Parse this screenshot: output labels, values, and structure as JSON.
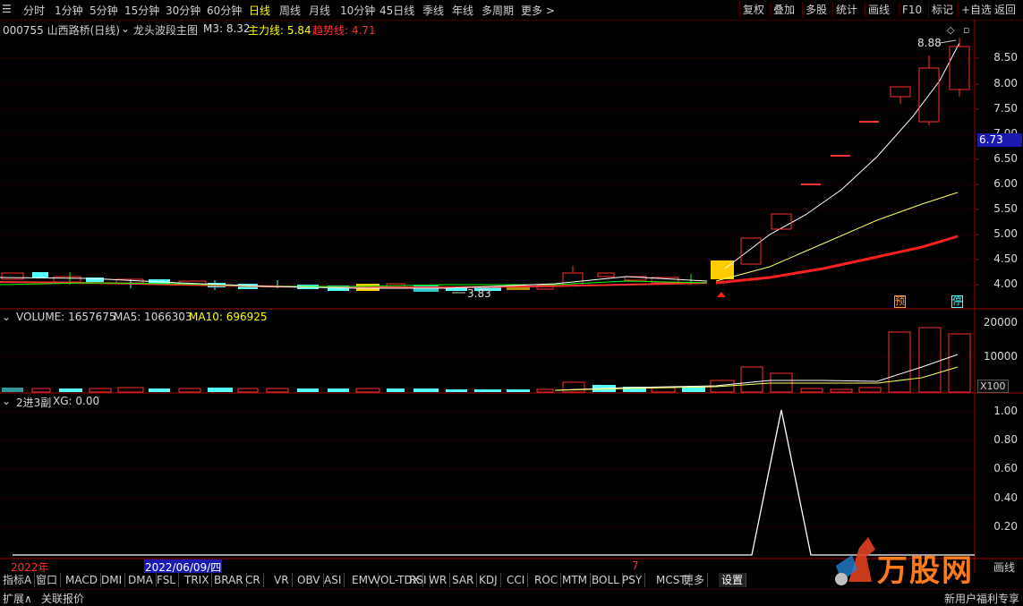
{
  "periods": [
    "分时",
    "1分钟",
    "5分钟",
    "15分钟",
    "30分钟",
    "60分钟",
    "日线",
    "周线",
    "月线",
    "10分钟",
    "45日线",
    "季线",
    "年线",
    "多周期",
    "更多 >"
  ],
  "active_period": "日线",
  "right_buttons": [
    "复权",
    "叠加",
    "多股",
    "统计",
    "画线",
    "F10",
    "标记",
    "+自选",
    "返回"
  ],
  "stock": {
    "code_name": "000755 山西路桥(日线)",
    "indicator_name": "龙头波段主图",
    "m3_label": "M3: 8.32",
    "main_line_label": "主力线: 5.84",
    "trend_line_label": "趋势线: 4.71"
  },
  "price_axis": [
    "8.50",
    "8.00",
    "7.50",
    "7.00",
    "6.50",
    "6.00",
    "5.50",
    "5.00",
    "4.50",
    "4.00"
  ],
  "current_price": "6.73",
  "high_label": "8.88",
  "low_label": "3.83",
  "markers": {
    "pre": "预",
    "limit": "停"
  },
  "volume": {
    "label": "VOLUME: 1657675",
    "ma5": "MA5: 1066303",
    "ma10": "MA10: 696925",
    "axis": [
      "20000",
      "10000"
    ],
    "unit": "X100"
  },
  "sub": {
    "label": "2进3副",
    "xg": "XG: 0.00",
    "axis": [
      "1.00",
      "0.80",
      "0.60",
      "0.40",
      "0.20"
    ]
  },
  "dates": {
    "year": "2022年",
    "cursor": "2022/06/09/四",
    "month": "7"
  },
  "bottom_tabs": [
    "指标A",
    "窗口",
    "MACD",
    "DMI",
    "DMA",
    "FSL",
    "TRIX",
    "BRAR",
    "CR",
    "VR",
    "OBV",
    "ASI",
    "EMV",
    "VOL-TDX",
    "RSI",
    "WR",
    "SAR",
    "KDJ",
    "CCI",
    "ROC",
    "MTM",
    "BOLL",
    "PSY",
    "MCST",
    "更多",
    "设置"
  ],
  "status": {
    "expand": "扩展∧",
    "linked": "关联报价",
    "right_text": "新用户福利专享",
    "line_text": "画线"
  },
  "logo_text": "万股网",
  "colors": {
    "up": "#ff3030",
    "down": "#54ffff",
    "accent": "#ffff00",
    "bg": "#000000"
  }
}
